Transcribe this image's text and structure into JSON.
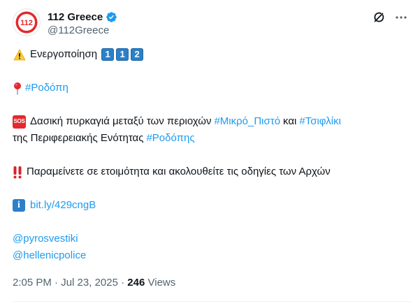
{
  "author": {
    "display_name": "112 Greece",
    "handle": "@112Greece",
    "avatar_text": "112"
  },
  "tweet": {
    "line1_text": "Ενεργοποίηση",
    "keycaps": [
      "1",
      "1",
      "2"
    ],
    "line2_hashtag": "#Ροδόπη",
    "line3_text": "Δασική πυρκαγιά μεταξύ των περιοχών",
    "line3_hashtag1": "#Μικρό_Πιστό",
    "line3_conj": "και",
    "line3_hashtag2": "#Τσιφλίκι",
    "line4_text": "της Περιφερειακής Ενότητας",
    "line4_hashtag": "#Ροδόπης",
    "line5_text": "Παραμείνετε σε ετοιμότητα και ακολουθείτε τις οδηγίες των Αρχών",
    "sos_label": "SOS",
    "info_label": "i",
    "link_text": "bit.ly/429cngB",
    "mention1": "@pyrosvestiki",
    "mention2": "@hellenicpolice"
  },
  "meta": {
    "time": "2:05 PM",
    "date": "Jul 23, 2025",
    "separator1": "·",
    "separator2": "·",
    "views_count": "246",
    "views_label": "Views"
  },
  "icons": {
    "verified": "verified-badge-icon",
    "grok": "grok-icon",
    "more": "more-icon",
    "warning": "warning-icon",
    "pin": "round-pushpin-icon",
    "sos": "sos-icon",
    "double_exclamation": "double-exclamation-icon",
    "info": "information-icon"
  },
  "colors": {
    "link": "#1d9bf0",
    "text": "#0f1419",
    "secondary": "#536471",
    "avatar_red": "#e3292e"
  }
}
